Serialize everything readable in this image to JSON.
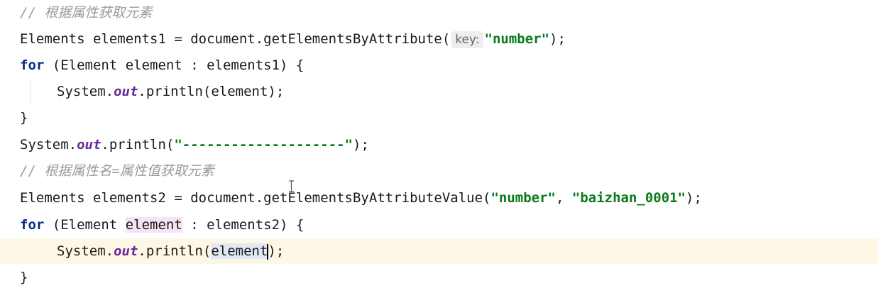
{
  "code": {
    "line1_comment": "// 根据属性获取元素",
    "line2_decl": "Elements elements1 = document.getElementsByAttribute(",
    "line2_hint": "key:",
    "line2_str": "\"number\"",
    "line2_end": ");",
    "line3_kw": "for",
    "line3_rest": " (Element element : elements1) {",
    "line4_a": "System.",
    "line4_field": "out",
    "line4_b": ".println(element);",
    "line5_brace": "}",
    "line6_a": "System.",
    "line6_field": "out",
    "line6_b": ".println(",
    "line6_str": "\"--------------------\"",
    "line6_end": ");",
    "line7_comment": "// 根据属性名=属性值获取元素",
    "line8_decl": "Elements elements2 = document.getElementsByAttributeValue(",
    "line8_str1": "\"number\"",
    "line8_sep": ", ",
    "line8_str2": "\"baizhan_0001\"",
    "line8_end": ");",
    "line9_kw": "for",
    "line9_a": " (Element ",
    "line9_var": "element",
    "line9_b": " : elements2) {",
    "line10_a": "System.",
    "line10_field": "out",
    "line10_b": ".println(",
    "line10_var": "element",
    "line10_end": ");",
    "line11_brace": "}"
  },
  "colors": {
    "keyword": "#0b2a8a",
    "string": "#0a7a1a",
    "field": "#6a2a9a",
    "comment": "#9a9a9a",
    "current_line": "#fdf8e6"
  }
}
